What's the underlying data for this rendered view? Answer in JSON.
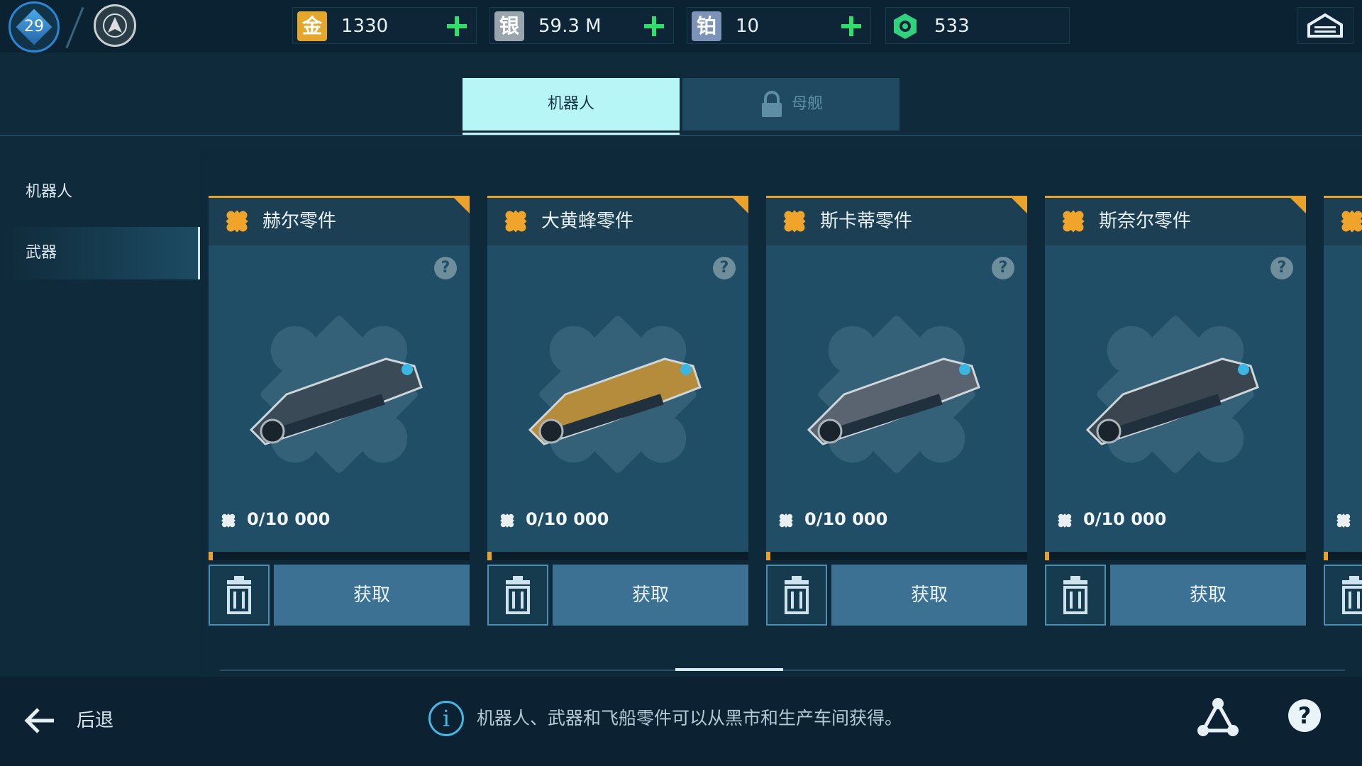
{
  "player": {
    "level": "29"
  },
  "currencies": [
    {
      "name": "gold",
      "glyph": "金",
      "value": "1330",
      "color": "#e4a72c"
    },
    {
      "name": "silver",
      "glyph": "银",
      "value": "59.3 M",
      "color": "#9aa6ad"
    },
    {
      "name": "platinum",
      "glyph": "铂",
      "value": "10",
      "color": "#7d93b8"
    },
    {
      "name": "key",
      "value": "533",
      "color": "#2fd27d"
    }
  ],
  "tabs": [
    {
      "label": "机器人",
      "active": true
    },
    {
      "label": "母舰",
      "locked": true
    }
  ],
  "sidebar": {
    "items": [
      {
        "label": "机器人"
      },
      {
        "label": "武器",
        "active": true
      }
    ]
  },
  "cards": [
    {
      "title": "赫尔零件",
      "count": "0/10 000",
      "get_label": "获取",
      "weapon_color": "#3b4a57"
    },
    {
      "title": "大黄蜂零件",
      "count": "0/10 000",
      "get_label": "获取",
      "weapon_color": "#b48c3c"
    },
    {
      "title": "斯卡蒂零件",
      "count": "0/10 000",
      "get_label": "获取",
      "weapon_color": "#596470"
    },
    {
      "title": "斯奈尔零件",
      "count": "0/10 000",
      "get_label": "获取",
      "weapon_color": "#3a4550"
    }
  ],
  "footer": {
    "back_label": "后退",
    "info_text": "机器人、武器和飞船零件可以从黑市和生产车间获得。"
  },
  "colors": {
    "accent_orange": "#e9a32b",
    "tab_active": "#b6f6f6",
    "plus_green": "#2ee06a"
  }
}
